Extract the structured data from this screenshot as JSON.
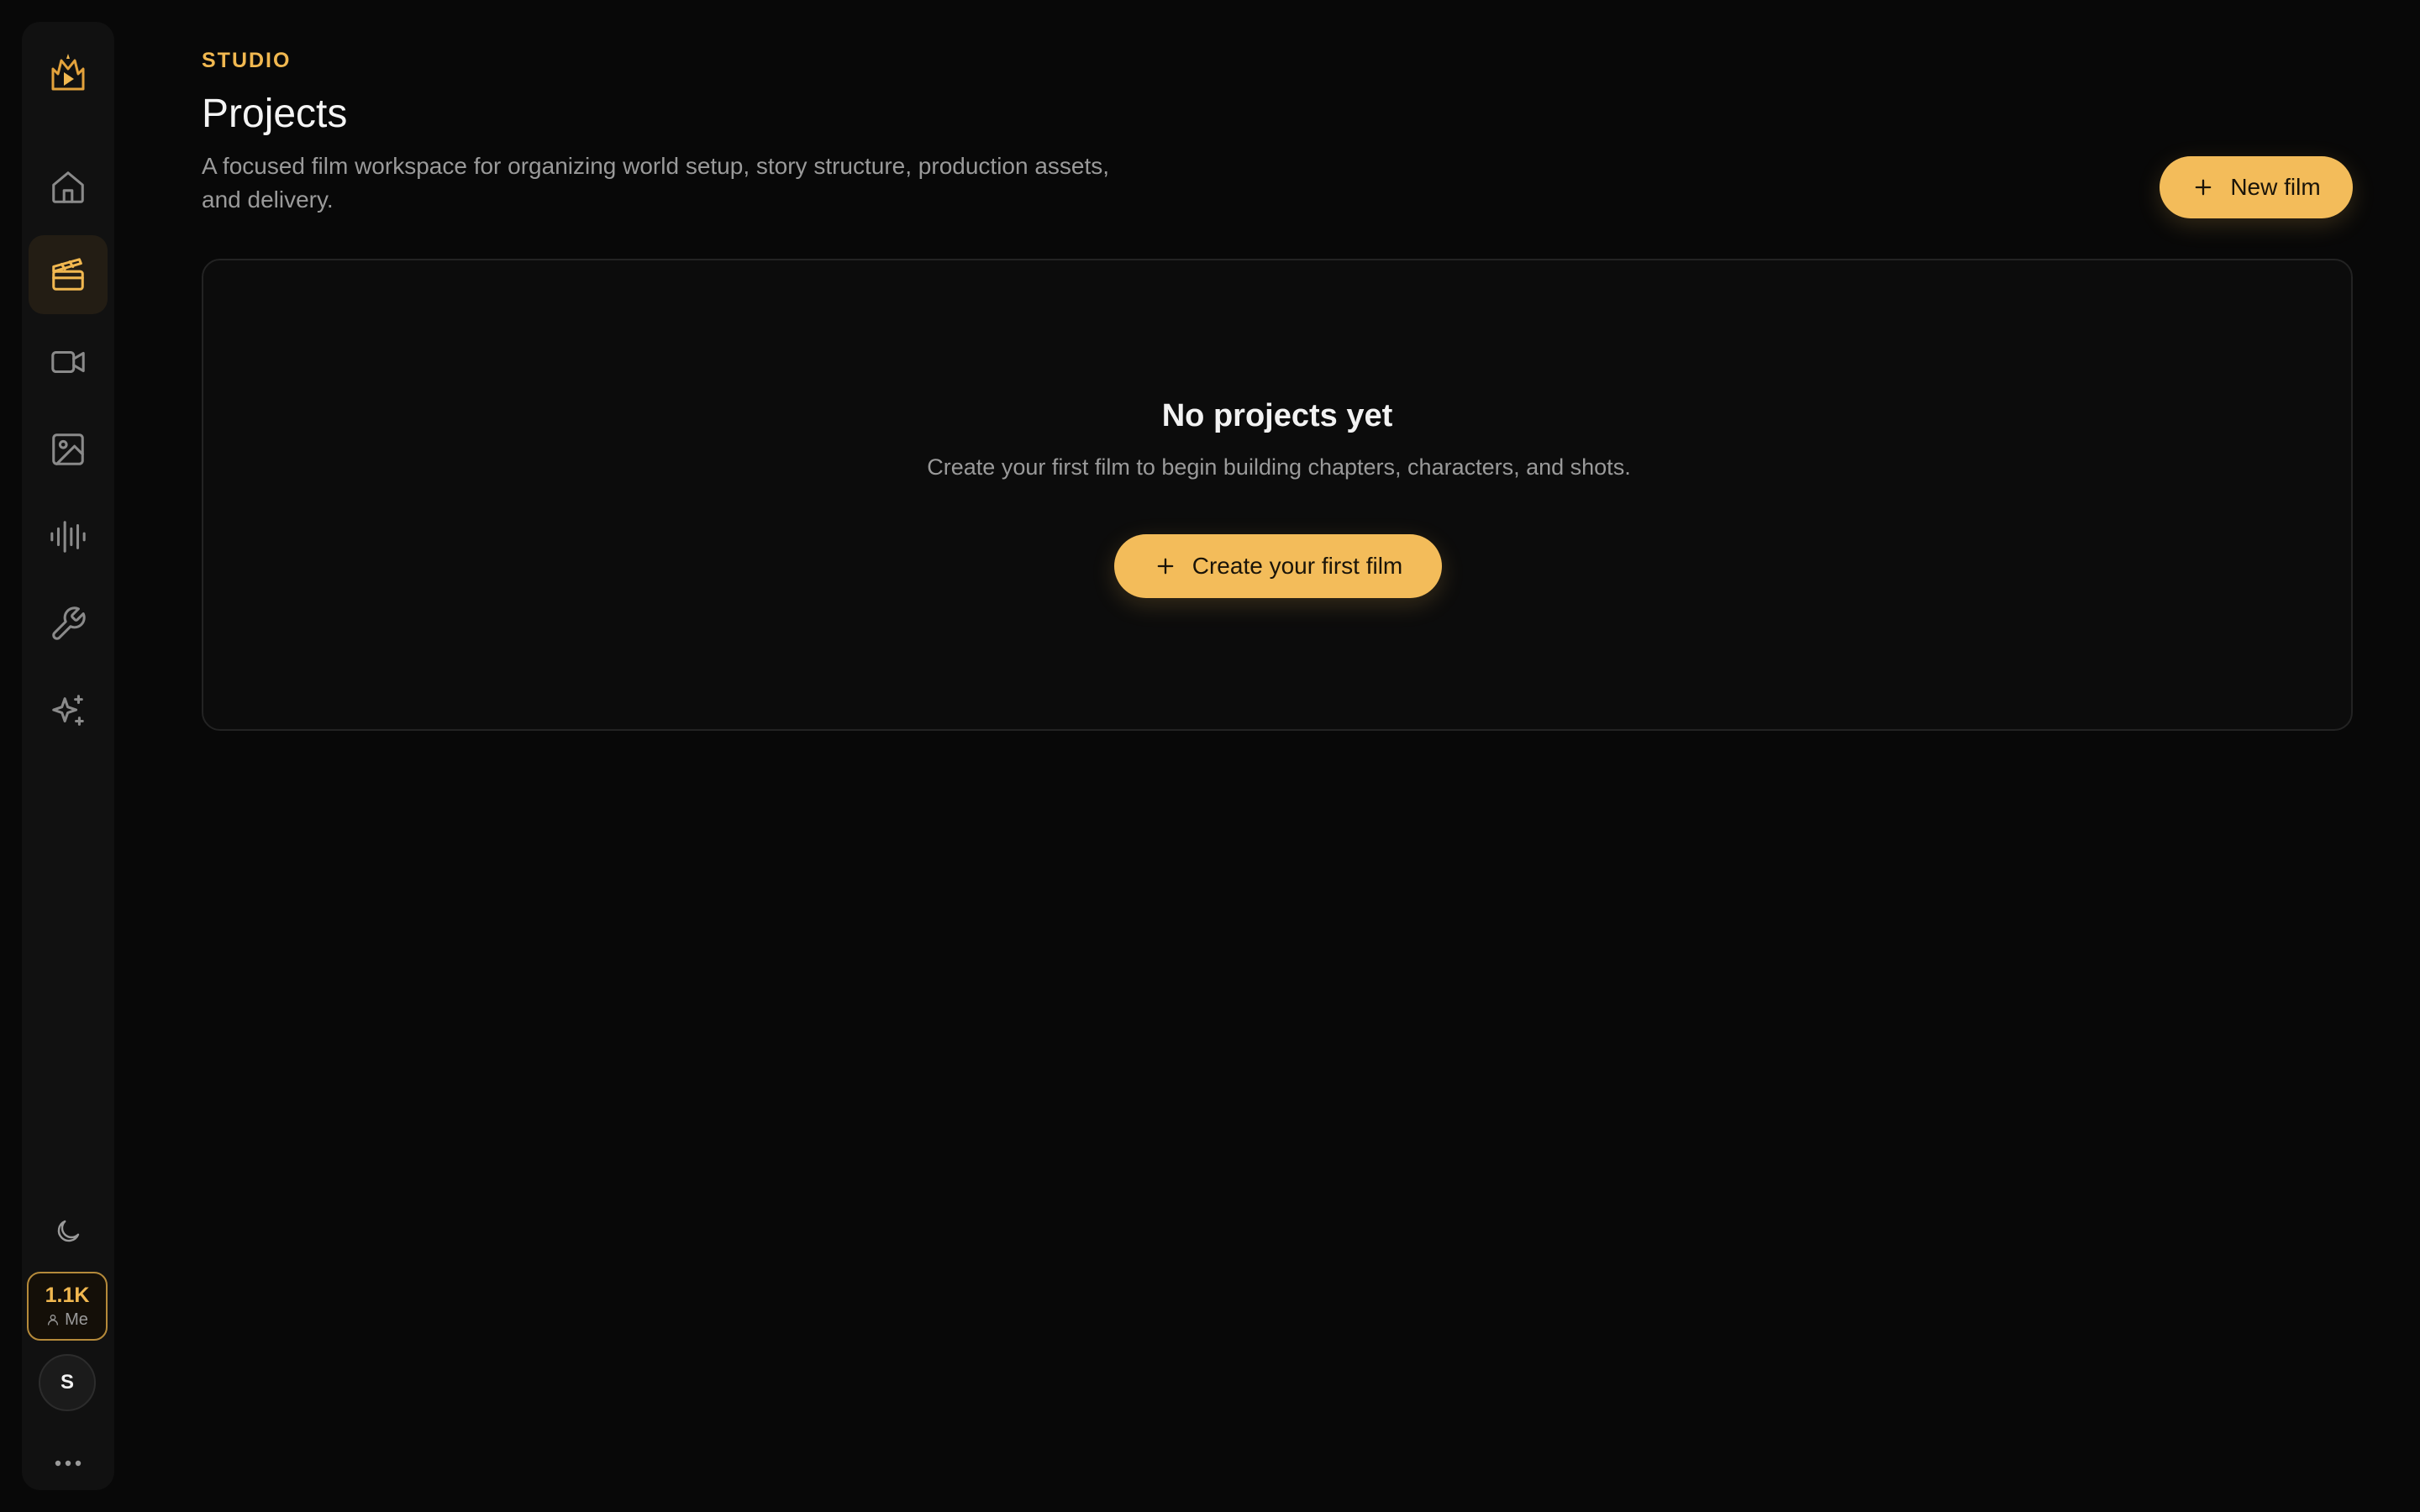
{
  "sidebar": {
    "items": [
      {
        "name": "home",
        "icon": "home-icon",
        "active": false
      },
      {
        "name": "projects",
        "icon": "clapperboard-icon",
        "active": true
      },
      {
        "name": "video",
        "icon": "video-camera-icon",
        "active": false
      },
      {
        "name": "images",
        "icon": "image-icon",
        "active": false
      },
      {
        "name": "audio",
        "icon": "audio-waveform-icon",
        "active": false
      },
      {
        "name": "tools",
        "icon": "wrench-icon",
        "active": false
      },
      {
        "name": "ai",
        "icon": "sparkles-icon",
        "active": false
      }
    ],
    "credits": {
      "amount": "1.1K",
      "owner": "Me"
    },
    "avatar_initial": "S"
  },
  "header": {
    "eyebrow": "STUDIO",
    "title": "Projects",
    "subtitle": "A focused film workspace for organizing world setup, story structure, production assets, and delivery.",
    "new_button_label": "New film"
  },
  "empty_state": {
    "title": "No projects yet",
    "description": "Create your first film to begin building chapters, characters, and shots.",
    "button_label": "Create your first film"
  },
  "colors": {
    "accent": "#f3bc5a",
    "background": "#080808",
    "sidebar": "#111111",
    "muted_text": "#9a9a9a"
  }
}
